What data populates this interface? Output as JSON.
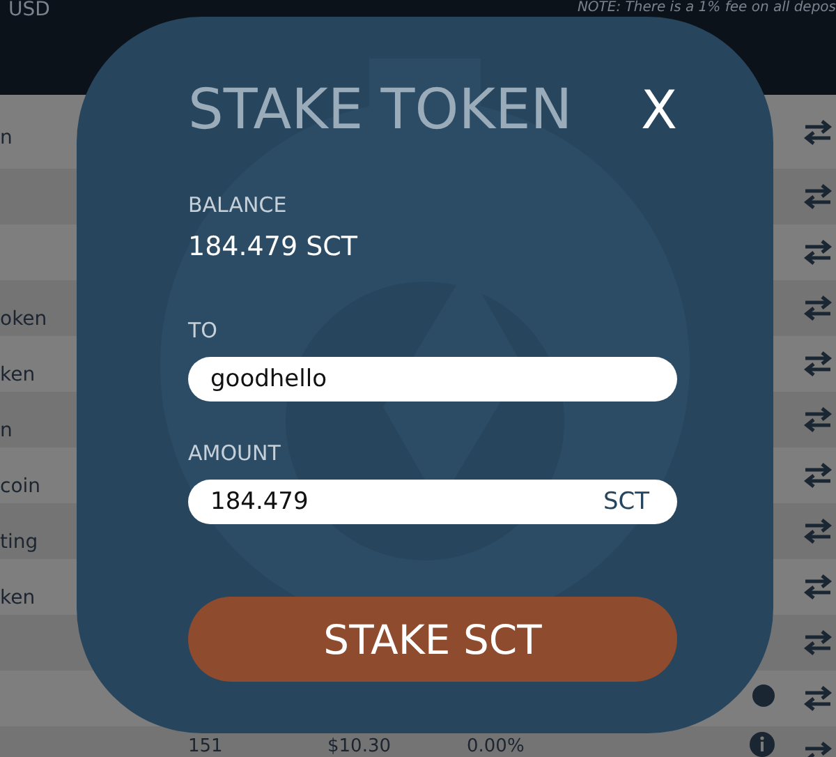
{
  "header": {
    "currency": "USD",
    "note": "NOTE: There is a 1% fee on all depos"
  },
  "rows": [
    {
      "kind": "plain",
      "name": "n"
    },
    {
      "kind": "plain"
    },
    {
      "kind": "plain"
    },
    {
      "kind": "plain",
      "name": "oken"
    },
    {
      "kind": "plain",
      "name": "ken"
    },
    {
      "kind": "plain",
      "name": "n"
    },
    {
      "kind": "plain",
      "name": "coin"
    },
    {
      "kind": "plain",
      "name": "ting"
    },
    {
      "kind": "plain",
      "name": "ken"
    },
    {
      "kind": "plain"
    },
    {
      "kind": "status"
    },
    {
      "kind": "stats",
      "cells": [
        "151",
        "$10.30",
        "0.00%"
      ]
    }
  ],
  "modal": {
    "title": "STAKE TOKEN",
    "close": "X",
    "balance_label": "BALANCE",
    "balance": "184.479 SCT",
    "to_label": "TO",
    "to_value": "goodhello",
    "amount_label": "AMOUNT",
    "amount_value": "184.479",
    "amount_unit": "SCT",
    "submit": "STAKE SCT"
  }
}
